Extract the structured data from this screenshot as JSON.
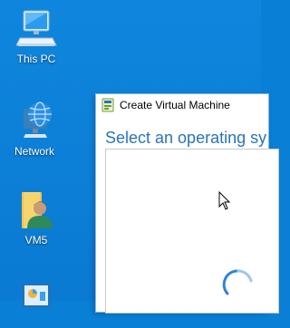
{
  "desktop": {
    "icons": [
      {
        "label": "This PC",
        "icon": "computer-icon"
      },
      {
        "label": "Network",
        "icon": "network-globe-icon"
      },
      {
        "label": "VM5",
        "icon": "user-folder-icon"
      },
      {
        "label": "",
        "icon": "control-panel-icon"
      }
    ]
  },
  "window": {
    "title": "Create Virtual Machine",
    "heading": "Select an operating sy",
    "app_icon": "vm-wizard-icon",
    "status": "loading-spinner"
  },
  "colors": {
    "desktop_bg": "#0a7fd6",
    "heading": "#2a73b8",
    "spinner": "#2e84d6"
  }
}
